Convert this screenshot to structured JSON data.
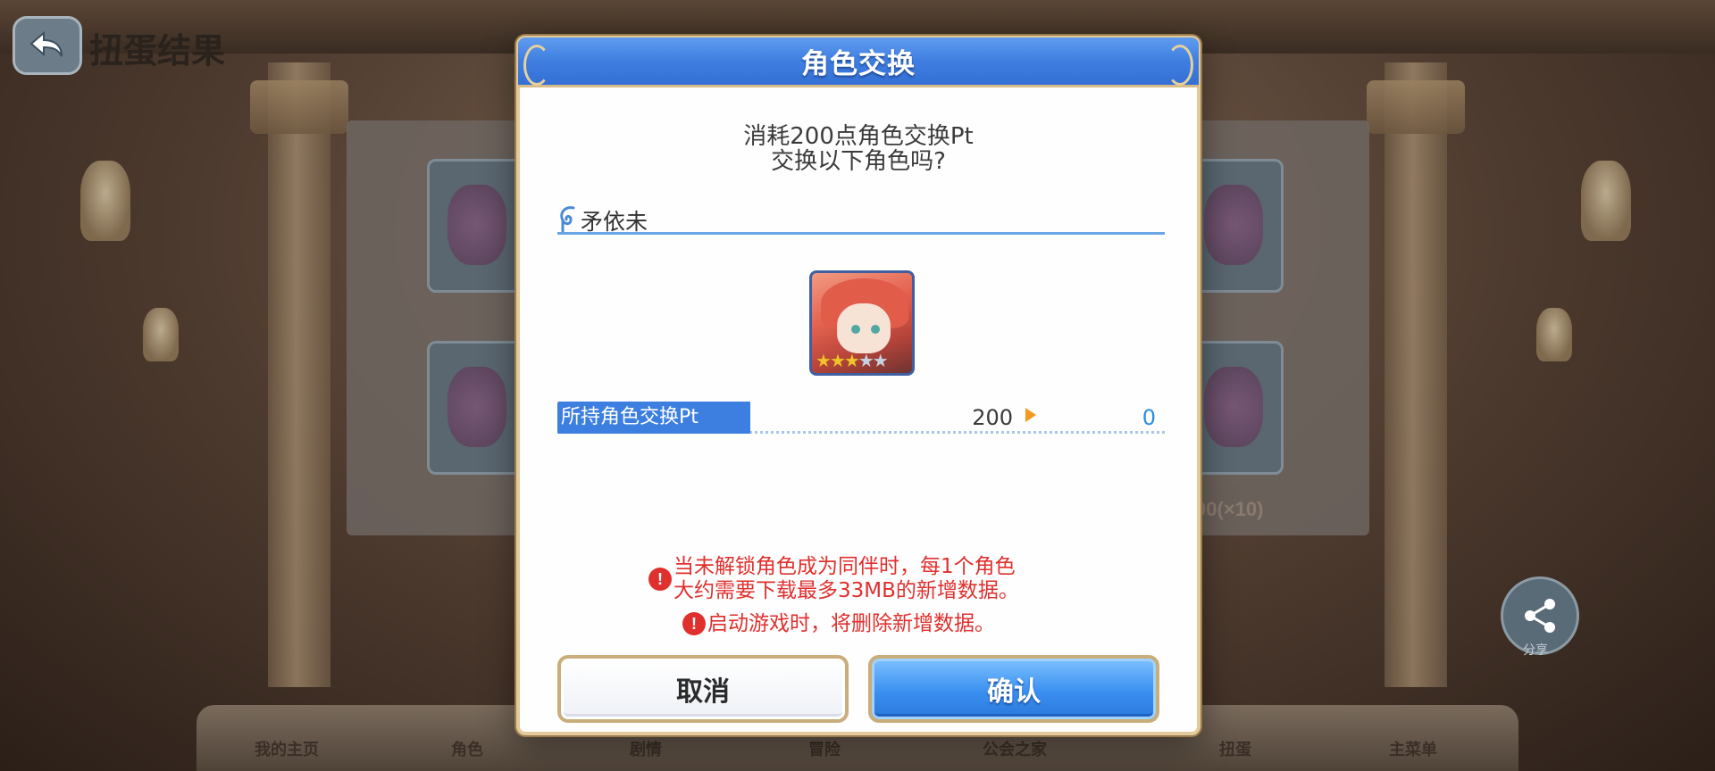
{
  "background": {
    "top_title": "扭蛋结果",
    "share_label": "分享",
    "side_text": "00(×10)",
    "bottom_nav": [
      "我的主页",
      "角色",
      "剧情",
      "冒险",
      "公会之家",
      "扭蛋",
      "主菜单"
    ]
  },
  "dialog": {
    "title": "角色交换",
    "message_line1": "消耗200点角色交换Pt",
    "message_line2": "交换以下角色吗?",
    "character_name": "矛依未",
    "character_stars": 3,
    "pt_label": "所持角色交换Pt",
    "pt_before": "200",
    "pt_after": "0",
    "warning1_line1": "当未解锁角色成为同伴时，每1个角色",
    "warning1_line2": "大约需要下载最多33MB的新增数据。",
    "warning2": "启动游戏时，将删除新增数据。",
    "cancel_label": "取消",
    "confirm_label": "确认"
  },
  "colors": {
    "header_blue": "#3f7ee0",
    "accent_gold": "#e4c99a",
    "warning_red": "#e0302e",
    "pt_after_blue": "#2e8de0",
    "arrow_orange": "#f39a1f"
  }
}
